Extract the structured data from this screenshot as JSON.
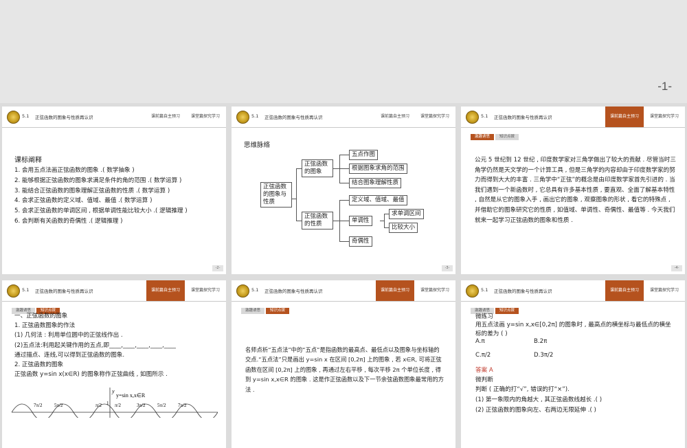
{
  "page_number": "-1-",
  "common": {
    "lesson_code": "5.1",
    "lesson_title": "正弦函数的图象与性质再认识",
    "tab1": "课前篇自主预习",
    "tab2": "课堂篇探究学习",
    "subtab1": "激趣诱思",
    "subtab2": "知识点拨"
  },
  "slide1": {
    "heading": "课标阐释",
    "items": [
      "1. 会用五点法画正弦函数的图象 .( 数学抽象 )",
      "2. 能够根据正弦函数的图象求满足条件的角的范围 .( 数学运算 )",
      "3. 能结合正弦函数的图象理解正弦函数的性质 .( 数学运算 )",
      "4. 会求正弦函数的定义域、值域、最值 .( 数学运算 )",
      "5. 会求正弦函数的单调区间 , 根据单调性能比较大小 .( 逻辑推理 )",
      "6. 会判断有关函数的奇偶性 .( 逻辑推理 )"
    ],
    "footer": "-2-"
  },
  "slide2": {
    "heading": "思维脉络",
    "root": "正弦函数的图象与性质",
    "graph": "正弦函数的图象",
    "graph_children": [
      "五点作图",
      "根据图象求角的范围",
      "结合图象理解性质"
    ],
    "props": "正弦函数的性质",
    "props_children": [
      "定义域、值域、最值",
      "单调性",
      "奇偶性"
    ],
    "mono_children": [
      "求单调区间",
      "比较大小"
    ],
    "footer": "-3-"
  },
  "slide3": {
    "paragraph": "公元 5 世纪到 12 世纪 , 印度数学家对三角学做出了较大的贡献 . 尽管当时三角学仍然是天文学的一个计算工具 , 但是三角学的内容却由于印度数学家的努力而得到大大的丰富 . 三角学中“正弦”的概念是由印度数学家首先引进的 . 当我们遇到一个新函数时 , 它总具有许多基本性质 , 要直观、全面了解基本特性 , 自然是从它的图象入手 , 画出它的图象 , 观察图象的形状 , 看它的特殊点 , 并借助它的图象研究它的性质 , 如值域、单调性、奇偶性、最值等 . 今天我们就来一起学习正弦函数的图象和性质 .",
    "footer": "-4-"
  },
  "slide4": {
    "lines": [
      "一、正弦函数的图象",
      "1. 正弦函数图象的作法",
      "(1) 几何法 : 利用单位圆中的正弦线作出 .",
      "(2)五点法:利用起关键作用的五点,即____,____,____,____,____",
      "通过描点、连线,可以得到正弦函数的图象.",
      "2. 正弦函数的图象",
      "正弦函数 y=sin x(x∈R) 的图象称作正弦曲线 , 如图所示 ."
    ],
    "graph_label": "y=sin x,x∈R",
    "axis_y": "y",
    "axis_one": "1",
    "ticks": [
      "7π/2",
      "5π/2",
      "π/2",
      "π/2",
      "3π/2",
      "5π/2",
      "7π/2"
    ]
  },
  "slide5": {
    "paragraph": "名师点析“五点法”中的“五点”是指函数的最高点、最低点以及图象与坐标轴的交点.“五点法”只是画出 y=sin x 在区间 [0,2π] 上的图象 , 若 x∈R, 可将正弦函数在区间 [0,2π] 上的图象 , 再通过左右平移 , 每次平移 2π 个单位长度 , 得到 y=sin x,x∈R 的图象 . 这是作正弦函数以及下一节余弦函数图象最常用的方法 ."
  },
  "slide6": {
    "lines": [
      "微练习",
      "用五点法画 y=sin x,x∈[0,2π] 的图象时 , 最高点的横坐标与最低点的横坐标的差为 (        )",
      "A.π",
      "B.2π",
      "C.π/2",
      "D.3π/2",
      "答案 A",
      "微判断",
      "判断 ( 正确的打“√”, 错误的打“×”).",
      "(1) 第一象限内的角越大 , 其正弦函数线越长 .(        )",
      "(2) 正弦函数的图象向左、右两边无限延伸 .(        )"
    ],
    "answer_color": "#c0392b"
  }
}
